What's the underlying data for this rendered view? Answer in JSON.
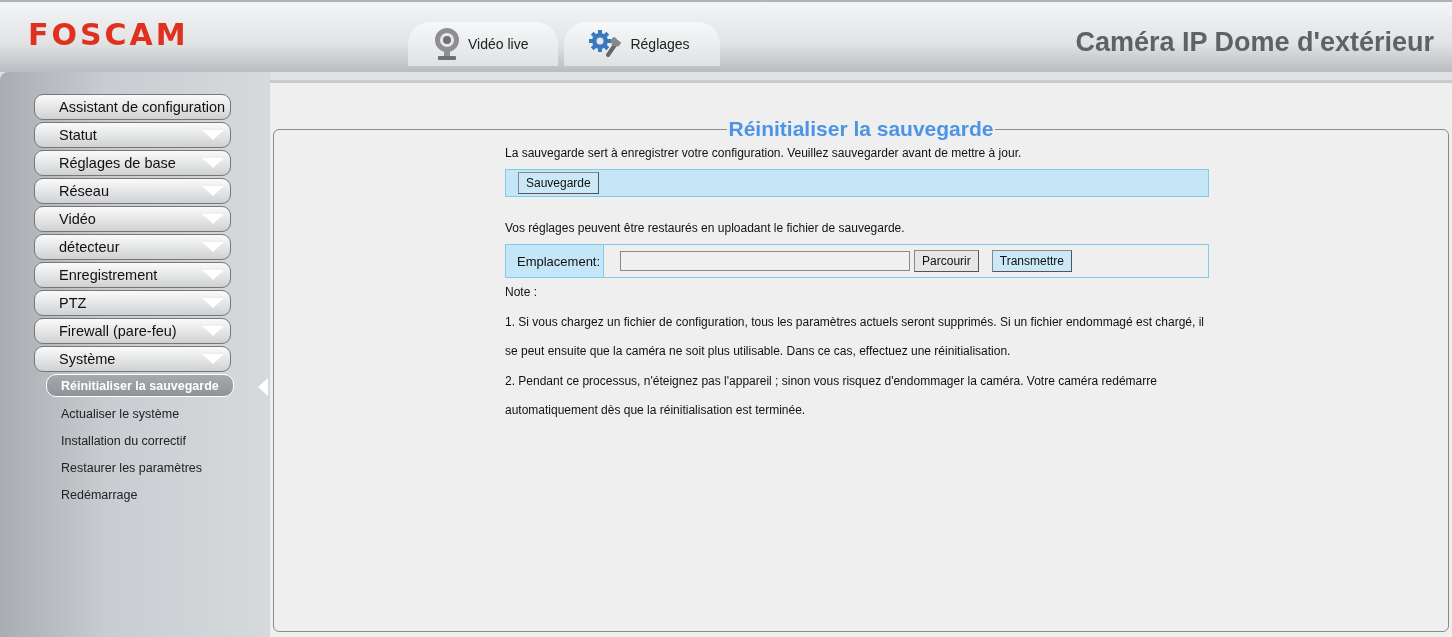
{
  "header": {
    "logo": "FOSCAM",
    "tabs": [
      {
        "label": "Vidéo live",
        "kind": "webcam"
      },
      {
        "label": "Réglages",
        "kind": "gears"
      }
    ],
    "product_title": "Caméra IP Dome d'extérieur"
  },
  "sidebar": {
    "items": [
      {
        "label": "Assistant de configuration",
        "kind": "link"
      },
      {
        "label": "Statut",
        "kind": "group"
      },
      {
        "label": "Réglages de base",
        "kind": "group"
      },
      {
        "label": "Réseau",
        "kind": "group"
      },
      {
        "label": "Vidéo",
        "kind": "group"
      },
      {
        "label": "détecteur",
        "kind": "group"
      },
      {
        "label": "Enregistrement",
        "kind": "group"
      },
      {
        "label": "PTZ",
        "kind": "group"
      },
      {
        "label": "Firewall (pare-feu)",
        "kind": "group"
      },
      {
        "label": "Système",
        "kind": "group",
        "children": [
          {
            "label": "Réinitialiser la sauvegarde",
            "selected": true
          },
          {
            "label": "Actualiser le système",
            "selected": false
          },
          {
            "label": "Installation du correctif",
            "selected": false
          },
          {
            "label": "Restaurer les paramètres",
            "selected": false
          },
          {
            "label": "Redémarrage",
            "selected": false
          }
        ]
      }
    ]
  },
  "panel": {
    "title": "Réinitialiser la sauvegarde",
    "backup_text": "La sauvegarde sert à enregistrer votre configuration. Veuillez sauvegarder avant de mettre à jour.",
    "backup_button": "Sauvegarde",
    "restore_text": "Vos réglages peuvent être restaurés en uploadant le fichier de sauvegarde.",
    "location_label": "Emplacement:",
    "browse_button": "Parcourir",
    "submit_button": "Transmettre",
    "note_title": "Note :",
    "notes": [
      "1. Si vous chargez un fichier de configuration, tous les paramètres actuels seront supprimés. Si un fichier endommagé est chargé, il se peut ensuite que la caméra ne soit plus utilisable. Dans ce cas, effectuez une réinitialisation.",
      "2. Pendant ce processus, n'éteignez pas l'appareil ; sinon vous risquez d'endommager la caméra. Votre caméra redémarre automatiquement dès que la réinitialisation est terminée."
    ]
  }
}
